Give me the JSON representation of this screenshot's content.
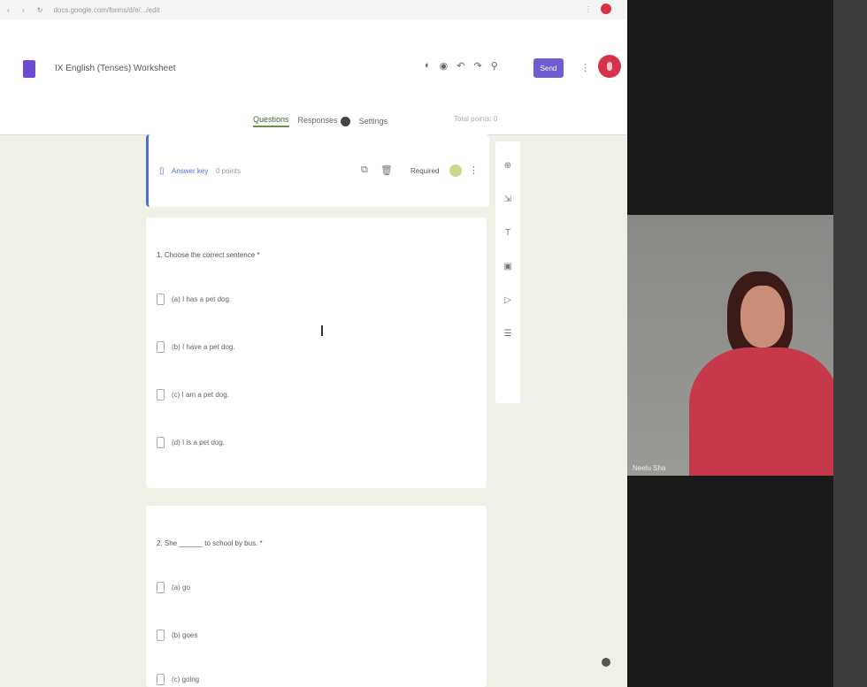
{
  "browser": {
    "url": "docs.google.com/forms/d/e/.../edit",
    "nav": "‹ › ↻"
  },
  "form": {
    "title": "IX English (Tenses) Worksheet",
    "send_label": "Send",
    "tabs": {
      "questions": "Questions",
      "responses": "Responses",
      "settings": "Settings"
    },
    "total_points": "Total points: 0",
    "answer_key": "Answer key",
    "points": "0 points",
    "required": "Required"
  },
  "questions": [
    {
      "text": "1. Choose the correct sentence *",
      "options": [
        "(a) I has a pet dog.",
        "(b) I have a pet dog.",
        "(c) I am a pet dog.",
        "(d) I is a pet dog."
      ]
    },
    {
      "text": "2. She ______ to school by bus. *",
      "options": [
        "(a) go",
        "(b) goes",
        "(c) going"
      ]
    }
  ],
  "participant": {
    "name": "Neelu Sha"
  },
  "colors": {
    "accent": "#6e5cd1",
    "active_tab": "#3d6a2e",
    "avatar": "#d6334b"
  },
  "icons": [
    "back-icon",
    "forward-icon",
    "reload-icon",
    "palette-icon",
    "preview-icon",
    "undo-icon",
    "redo-icon",
    "link-icon",
    "more-icon",
    "add-question-icon",
    "import-icon",
    "title-icon",
    "image-icon",
    "video-icon",
    "section-icon"
  ]
}
